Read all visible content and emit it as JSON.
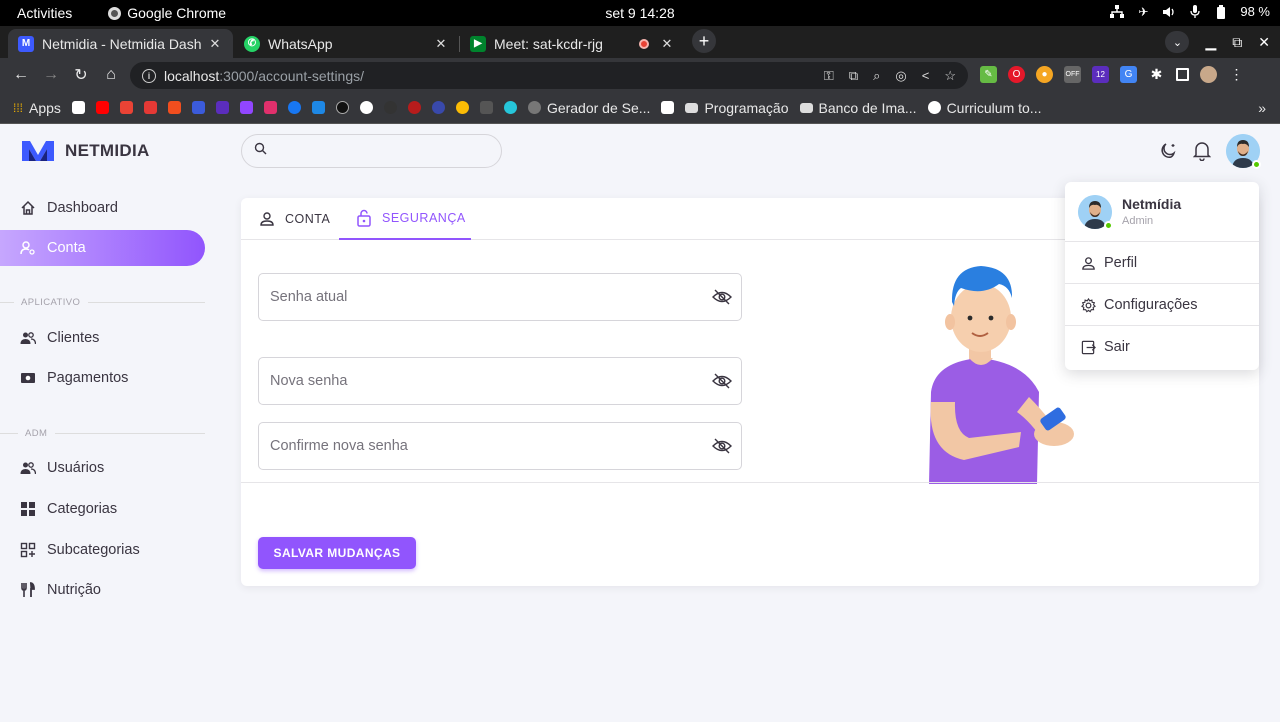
{
  "os": {
    "activities": "Activities",
    "app_name": "Google Chrome",
    "clock": "set 9  14:28",
    "battery": "98 %"
  },
  "browser": {
    "tabs": [
      {
        "title": "Netmidia - Netmidia Dash",
        "active": true
      },
      {
        "title": "WhatsApp",
        "active": false
      },
      {
        "title": "Meet: sat-kcdr-rjg",
        "active": false
      }
    ],
    "url_host": "localhost",
    "url_rest": ":3000/account-settings/",
    "extension_badge": "12",
    "extension_off": "OFF"
  },
  "bookmarks": {
    "apps": "Apps",
    "items": [
      "Gerador de Se...",
      "Programação",
      "Banco de Ima...",
      "Curriculum to..."
    ],
    "more": "»"
  },
  "app": {
    "brand": "NETMIDIA",
    "search": {
      "placeholder": ""
    },
    "sidebar": {
      "items": [
        {
          "label": "Dashboard",
          "icon": "home-icon"
        },
        {
          "label": "Conta",
          "icon": "account-cog-icon"
        }
      ],
      "section_app": "APLICATIVO",
      "app_items": [
        {
          "label": "Clientes",
          "icon": "people-icon"
        },
        {
          "label": "Pagamentos",
          "icon": "payments-icon"
        }
      ],
      "section_adm": "ADM",
      "adm_items": [
        {
          "label": "Usuários",
          "icon": "people-icon"
        },
        {
          "label": "Categorias",
          "icon": "grid-icon"
        },
        {
          "label": "Subcategorias",
          "icon": "grid-plus-icon"
        },
        {
          "label": "Nutrição",
          "icon": "utensils-icon"
        }
      ]
    },
    "tabs": [
      {
        "label": "CONTA"
      },
      {
        "label": "SEGURANÇA"
      }
    ],
    "fields": {
      "current_password": "Senha atual",
      "new_password": "Nova senha",
      "confirm_password": "Confirme nova senha"
    },
    "save_label": "SALVAR MUDANÇAS",
    "colors": {
      "primary": "#9155fd",
      "text": "#3a3541",
      "success": "#56ca00"
    }
  },
  "user_menu": {
    "name": "Netmídia",
    "role": "Admin",
    "items": [
      "Perfil",
      "Configurações",
      "Sair"
    ]
  }
}
